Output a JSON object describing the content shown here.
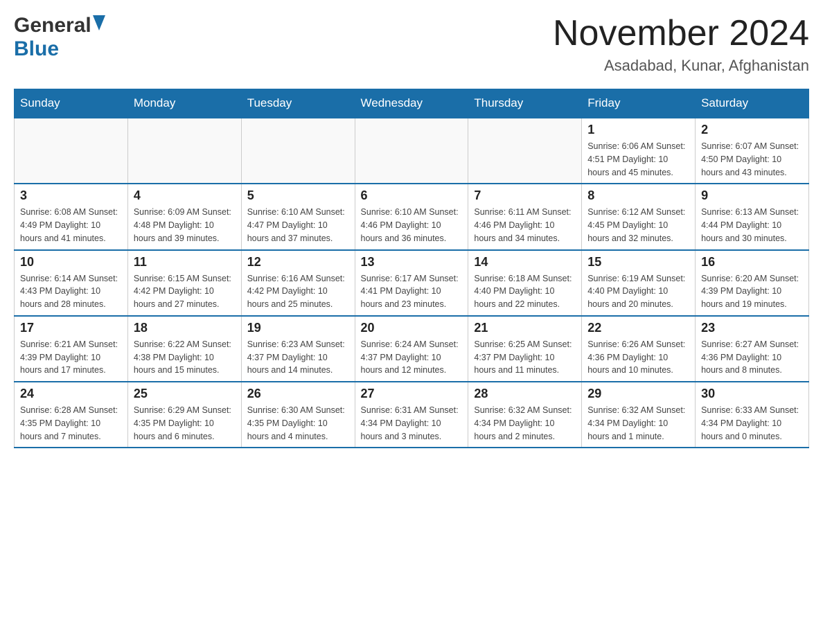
{
  "header": {
    "logo_general": "General",
    "logo_blue": "Blue",
    "main_title": "November 2024",
    "subtitle": "Asadabad, Kunar, Afghanistan"
  },
  "days_of_week": [
    "Sunday",
    "Monday",
    "Tuesday",
    "Wednesday",
    "Thursday",
    "Friday",
    "Saturday"
  ],
  "weeks": [
    [
      {
        "day": "",
        "info": ""
      },
      {
        "day": "",
        "info": ""
      },
      {
        "day": "",
        "info": ""
      },
      {
        "day": "",
        "info": ""
      },
      {
        "day": "",
        "info": ""
      },
      {
        "day": "1",
        "info": "Sunrise: 6:06 AM\nSunset: 4:51 PM\nDaylight: 10 hours and 45 minutes."
      },
      {
        "day": "2",
        "info": "Sunrise: 6:07 AM\nSunset: 4:50 PM\nDaylight: 10 hours and 43 minutes."
      }
    ],
    [
      {
        "day": "3",
        "info": "Sunrise: 6:08 AM\nSunset: 4:49 PM\nDaylight: 10 hours and 41 minutes."
      },
      {
        "day": "4",
        "info": "Sunrise: 6:09 AM\nSunset: 4:48 PM\nDaylight: 10 hours and 39 minutes."
      },
      {
        "day": "5",
        "info": "Sunrise: 6:10 AM\nSunset: 4:47 PM\nDaylight: 10 hours and 37 minutes."
      },
      {
        "day": "6",
        "info": "Sunrise: 6:10 AM\nSunset: 4:46 PM\nDaylight: 10 hours and 36 minutes."
      },
      {
        "day": "7",
        "info": "Sunrise: 6:11 AM\nSunset: 4:46 PM\nDaylight: 10 hours and 34 minutes."
      },
      {
        "day": "8",
        "info": "Sunrise: 6:12 AM\nSunset: 4:45 PM\nDaylight: 10 hours and 32 minutes."
      },
      {
        "day": "9",
        "info": "Sunrise: 6:13 AM\nSunset: 4:44 PM\nDaylight: 10 hours and 30 minutes."
      }
    ],
    [
      {
        "day": "10",
        "info": "Sunrise: 6:14 AM\nSunset: 4:43 PM\nDaylight: 10 hours and 28 minutes."
      },
      {
        "day": "11",
        "info": "Sunrise: 6:15 AM\nSunset: 4:42 PM\nDaylight: 10 hours and 27 minutes."
      },
      {
        "day": "12",
        "info": "Sunrise: 6:16 AM\nSunset: 4:42 PM\nDaylight: 10 hours and 25 minutes."
      },
      {
        "day": "13",
        "info": "Sunrise: 6:17 AM\nSunset: 4:41 PM\nDaylight: 10 hours and 23 minutes."
      },
      {
        "day": "14",
        "info": "Sunrise: 6:18 AM\nSunset: 4:40 PM\nDaylight: 10 hours and 22 minutes."
      },
      {
        "day": "15",
        "info": "Sunrise: 6:19 AM\nSunset: 4:40 PM\nDaylight: 10 hours and 20 minutes."
      },
      {
        "day": "16",
        "info": "Sunrise: 6:20 AM\nSunset: 4:39 PM\nDaylight: 10 hours and 19 minutes."
      }
    ],
    [
      {
        "day": "17",
        "info": "Sunrise: 6:21 AM\nSunset: 4:39 PM\nDaylight: 10 hours and 17 minutes."
      },
      {
        "day": "18",
        "info": "Sunrise: 6:22 AM\nSunset: 4:38 PM\nDaylight: 10 hours and 15 minutes."
      },
      {
        "day": "19",
        "info": "Sunrise: 6:23 AM\nSunset: 4:37 PM\nDaylight: 10 hours and 14 minutes."
      },
      {
        "day": "20",
        "info": "Sunrise: 6:24 AM\nSunset: 4:37 PM\nDaylight: 10 hours and 12 minutes."
      },
      {
        "day": "21",
        "info": "Sunrise: 6:25 AM\nSunset: 4:37 PM\nDaylight: 10 hours and 11 minutes."
      },
      {
        "day": "22",
        "info": "Sunrise: 6:26 AM\nSunset: 4:36 PM\nDaylight: 10 hours and 10 minutes."
      },
      {
        "day": "23",
        "info": "Sunrise: 6:27 AM\nSunset: 4:36 PM\nDaylight: 10 hours and 8 minutes."
      }
    ],
    [
      {
        "day": "24",
        "info": "Sunrise: 6:28 AM\nSunset: 4:35 PM\nDaylight: 10 hours and 7 minutes."
      },
      {
        "day": "25",
        "info": "Sunrise: 6:29 AM\nSunset: 4:35 PM\nDaylight: 10 hours and 6 minutes."
      },
      {
        "day": "26",
        "info": "Sunrise: 6:30 AM\nSunset: 4:35 PM\nDaylight: 10 hours and 4 minutes."
      },
      {
        "day": "27",
        "info": "Sunrise: 6:31 AM\nSunset: 4:34 PM\nDaylight: 10 hours and 3 minutes."
      },
      {
        "day": "28",
        "info": "Sunrise: 6:32 AM\nSunset: 4:34 PM\nDaylight: 10 hours and 2 minutes."
      },
      {
        "day": "29",
        "info": "Sunrise: 6:32 AM\nSunset: 4:34 PM\nDaylight: 10 hours and 1 minute."
      },
      {
        "day": "30",
        "info": "Sunrise: 6:33 AM\nSunset: 4:34 PM\nDaylight: 10 hours and 0 minutes."
      }
    ]
  ]
}
